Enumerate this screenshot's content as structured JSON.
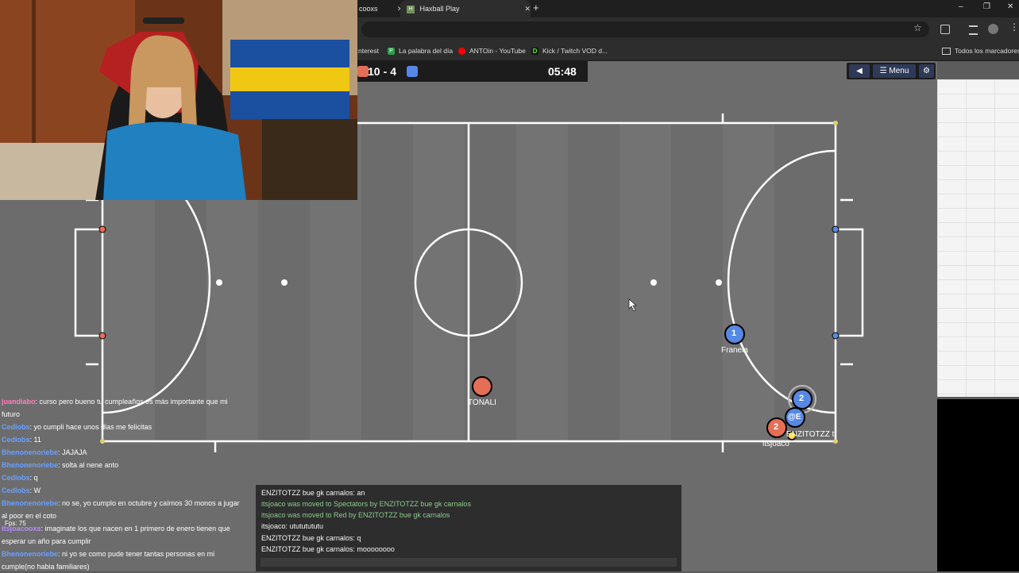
{
  "browser": {
    "tabs": [
      {
        "title": "cooxs",
        "close": "✕"
      },
      {
        "title": "Haxball Play",
        "close": "✕",
        "favicon": "H"
      }
    ],
    "new_tab": "+",
    "window": {
      "minimize": "–",
      "maximize": "❐",
      "close": "✕"
    },
    "bookmarks": [
      {
        "label": "nterest",
        "color": "#e60023"
      },
      {
        "label": "La palabra del día",
        "color": "#2e9e4d",
        "glyph": "P"
      },
      {
        "label": "ANTOin - YouTube",
        "color": "#ff0000"
      },
      {
        "label": "Kick / Twitch VOD d...",
        "color": "#53fc18",
        "glyph": "D"
      }
    ],
    "bookmarks_folder": "Todos los marcadores"
  },
  "game": {
    "score_red": "10",
    "score_sep": "-",
    "score_blue": "4",
    "time": "05:48",
    "menu_label": "Menu",
    "back_icon": "◀",
    "settings_icon": "⚙",
    "red_color": "#e56e56",
    "blue_color": "#5689e5",
    "players": [
      {
        "team": "blue",
        "number": "1",
        "name": "Franela"
      },
      {
        "team": "blue",
        "number": "2",
        "name": ""
      },
      {
        "team": "blue",
        "number": "@E",
        "name": "ENZITOTZZ t"
      },
      {
        "team": "red",
        "number": "2",
        "name": "itsjoaco"
      },
      {
        "team": "red",
        "number": "",
        "name": "TONALI"
      }
    ]
  },
  "stream_chat": [
    {
      "user": "juandiabo",
      "color": "#ff7fbf",
      "msg": ": curso pero bueno tu cumpleaños es más importante que mi futuro"
    },
    {
      "user": "Cedlobs",
      "color": "#6aa0ff",
      "msg": ": yo cumpli hace unos dias me felicitas"
    },
    {
      "user": "Cedlobs",
      "color": "#6aa0ff",
      "msg": ": 11"
    },
    {
      "user": "Bhenonenoriebe",
      "color": "#6aa0ff",
      "msg": ": JAJAJA"
    },
    {
      "user": "Bhenonenoriebe",
      "color": "#6aa0ff",
      "msg": ": solta al nene anto"
    },
    {
      "user": "Cedlobs",
      "color": "#6aa0ff",
      "msg": ": q"
    },
    {
      "user": "Cedlobs",
      "color": "#6aa0ff",
      "msg": ": W"
    },
    {
      "user": "Bhenonenoriebe",
      "color": "#6aa0ff",
      "msg": ": no se, yo cumplo en octubre y caímos 30 monos a jugar al poor en el coto"
    },
    {
      "user": "itsjoacooxs",
      "color": "#b98cff",
      "msg": ": imaginate los que nacen en 1 primero de enero tienen que esperar un año para cumplir"
    },
    {
      "user": "Bhenonenoriebe",
      "color": "#6aa0ff",
      "msg": ": ni yo se como pude tener tantas personas en mi cumple(no habia familiares)"
    }
  ],
  "fps_label": "Fps: 75",
  "game_chat": [
    {
      "text": "ENZITOTZZ bue gk carnalos: an",
      "system": false
    },
    {
      "text": "itsjoaco was moved to Spectators by ENZITOTZZ bue gk carnalos",
      "system": true
    },
    {
      "text": "itsjoaco was moved to Red by ENZITOTZZ bue gk carnalos",
      "system": true
    },
    {
      "text": "itsjoaco: utututututu",
      "system": false
    },
    {
      "text": "ENZITOTZZ bue gk carnalos: q",
      "system": false
    },
    {
      "text": "ENZITOTZZ bue gk carnalos: moooooooo",
      "system": false
    }
  ]
}
